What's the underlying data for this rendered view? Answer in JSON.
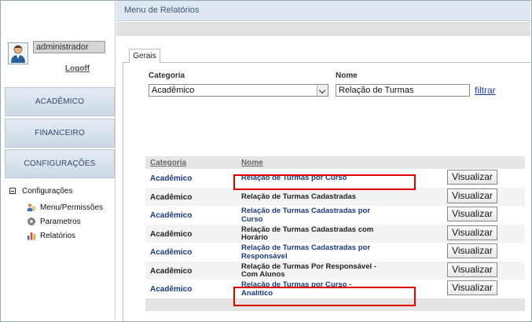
{
  "header": {
    "title": "Menu de Relatórios"
  },
  "user": {
    "name": "administrador",
    "logoff_label": "Logoff"
  },
  "menu": [
    {
      "label": "ACADÊMICO"
    },
    {
      "label": "FINANCEIRO"
    },
    {
      "label": "CONFIGURAÇÕES"
    }
  ],
  "tree": {
    "root": "Configurações",
    "items": [
      {
        "label": "Menu/Permissões",
        "icon": "users-key-icon"
      },
      {
        "label": "Parametros",
        "icon": "gear-icon"
      },
      {
        "label": "Relatórios",
        "icon": "bar-chart-icon"
      }
    ]
  },
  "tabs": [
    {
      "label": "Gerais"
    }
  ],
  "filters": {
    "categoria_label": "Categoria",
    "categoria_value": "Acadêmico",
    "nome_label": "Nome",
    "nome_value": "Relação de Turmas",
    "filter_link": "filtrar"
  },
  "table": {
    "columns": [
      "Categoria",
      "Nome"
    ],
    "button_label": "Visualizar",
    "rows": [
      {
        "categoria": "Acadêmico",
        "nome": "Relação de Turmas por Curso"
      },
      {
        "categoria": "Acadêmico",
        "nome": "Relação de Turmas Cadastradas"
      },
      {
        "categoria": "Acadêmico",
        "nome": "Relação de Turmas Cadastradas por Curso"
      },
      {
        "categoria": "Acadêmico",
        "nome": "Relação de Turmas Cadastradas com Horário"
      },
      {
        "categoria": "Acadêmico",
        "nome": "Relação de Turmas Cadastradas por Responsável"
      },
      {
        "categoria": "Acadêmico",
        "nome": "Relação de Turmas Por Responsável - Com Alunos"
      },
      {
        "categoria": "Acadêmico",
        "nome": "Relação de Turmas por Curso - Analítico"
      }
    ]
  },
  "colors": {
    "link": "#1a3a7a",
    "highlight": "#e00000",
    "header_bg": "#dfe8f0"
  }
}
